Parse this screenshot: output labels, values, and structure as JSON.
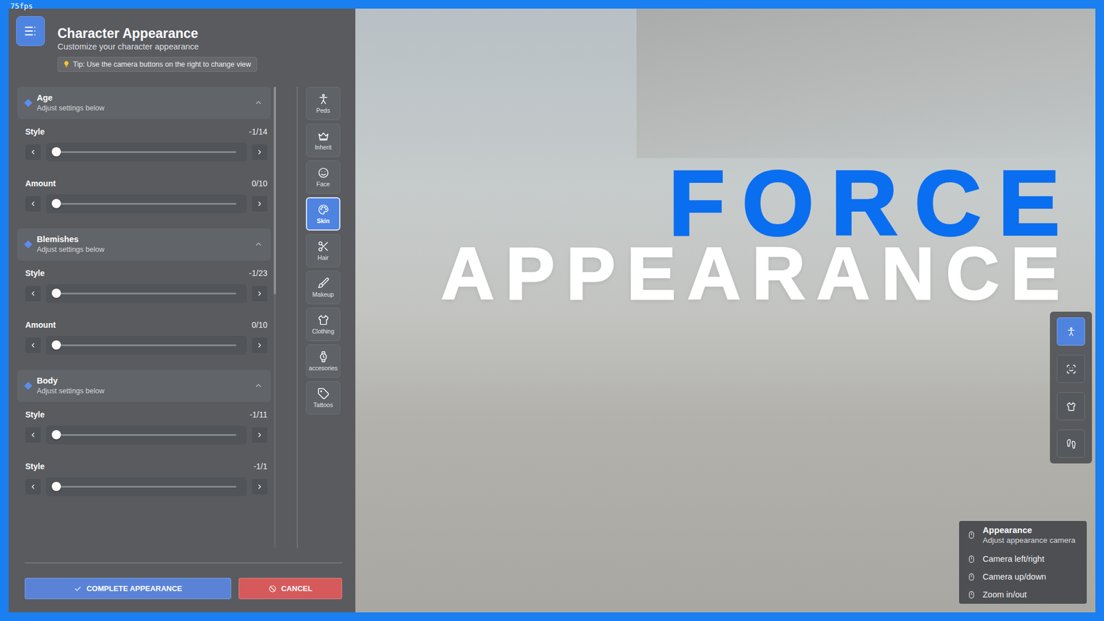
{
  "fps": "75fps",
  "header": {
    "title": "Character Appearance",
    "subtitle": "Customize your character appearance"
  },
  "tip": "Tip: Use the camera buttons on the right to change view",
  "sections": [
    {
      "title": "Age",
      "subtitle": "Adjust settings below",
      "expanded": true,
      "rows": [
        {
          "label": "Style",
          "value": "-1/14",
          "level": 0
        },
        {
          "label": "Amount",
          "value": "0/10",
          "level": 0
        }
      ]
    },
    {
      "title": "Blemishes",
      "subtitle": "Adjust settings below",
      "expanded": true,
      "rows": [
        {
          "label": "Style",
          "value": "-1/23",
          "level": 0
        },
        {
          "label": "Amount",
          "value": "0/10",
          "level": 0
        }
      ]
    },
    {
      "title": "Body",
      "subtitle": "Adjust settings below",
      "expanded": true,
      "rows": [
        {
          "label": "Style",
          "value": "-1/11",
          "level": 0
        },
        {
          "label": "Style",
          "value": "-1/1",
          "level": 0
        }
      ]
    }
  ],
  "scrollbar": {
    "level": 0.45
  },
  "categories": [
    {
      "label": "Peds",
      "selected": false
    },
    {
      "label": "Inherit",
      "selected": false
    },
    {
      "label": "Face",
      "selected": false
    },
    {
      "label": "Skin",
      "selected": true
    },
    {
      "label": "Hair",
      "selected": false
    },
    {
      "label": "Makeup",
      "selected": false
    },
    {
      "label": "Clothing",
      "selected": false
    },
    {
      "label": "accesories",
      "selected": false
    },
    {
      "label": "Tattoos",
      "selected": false
    }
  ],
  "buttons": {
    "complete": "COMPLETE APPEARANCE",
    "cancel": "CANCEL"
  },
  "title_overlay": {
    "line1": "FORCE",
    "line2": "APPEARANCE"
  },
  "camera_buttons": [
    {
      "selected": true
    },
    {
      "selected": false
    },
    {
      "selected": false
    },
    {
      "selected": false
    }
  ],
  "help": {
    "title": "Appearance",
    "subtitle": "Adjust appearance camera",
    "items": [
      "Camera left/right",
      "Camera up/down",
      "Zoom in/out"
    ]
  }
}
